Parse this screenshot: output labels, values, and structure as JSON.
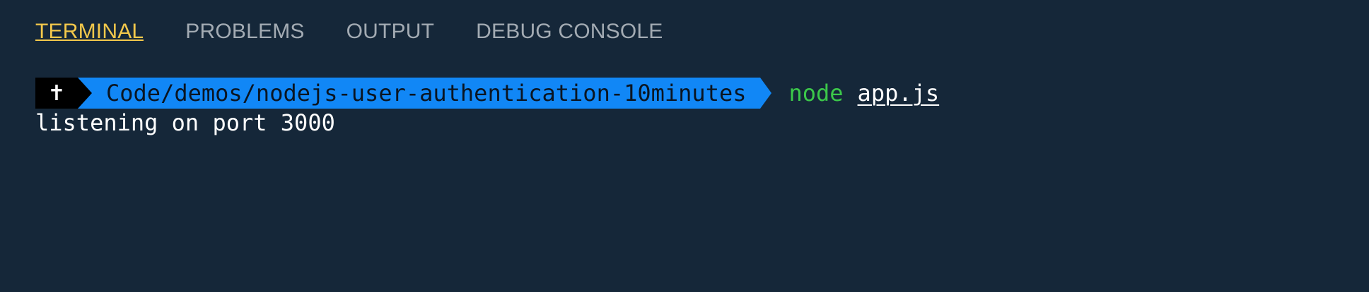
{
  "tabs": [
    {
      "label": "TERMINAL",
      "active": true
    },
    {
      "label": "PROBLEMS",
      "active": false
    },
    {
      "label": "OUTPUT",
      "active": false
    },
    {
      "label": "DEBUG CONSOLE",
      "active": false
    }
  ],
  "terminal": {
    "prompt_icon": "✝",
    "prompt_icon_name": "cross-icon",
    "path": "Code/demos/nodejs-user-authentication-10minutes",
    "command": "node",
    "argument": "app.js",
    "output_lines": [
      "listening on port 3000"
    ]
  },
  "colors": {
    "background": "#152739",
    "active_tab": "#f3c84b",
    "inactive_tab": "#a3abb3",
    "path_segment": "#1187f6",
    "command": "#3cc84a"
  }
}
